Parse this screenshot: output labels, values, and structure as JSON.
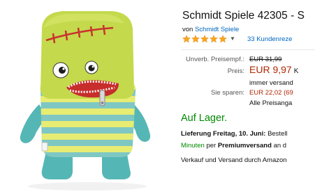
{
  "product": {
    "title": "Schmidt Spiele 42305 - S",
    "brand_prefix": "von",
    "brand": "Schmidt Spiele",
    "rating_stars": 5,
    "reviews": "33 Kundenreze"
  },
  "pricing": {
    "rrp_label": "Unverb. Preisempf.:",
    "rrp_value": "EUR 31,99",
    "price_label": "Preis:",
    "price_value": "EUR 9,97",
    "price_suffix": "K",
    "shipping_note": "immer versand",
    "savings_label": "Sie sparen:",
    "savings_value": "EUR 22,02 (69",
    "all_prices": "Alle Preisanga"
  },
  "availability": {
    "stock": "Auf Lager.",
    "delivery_prefix": "Lieferung Freitag, 10. Juni:",
    "delivery_suffix": "Bestell",
    "minutes": "Minuten",
    "per": "per",
    "premium": "Premiumversand",
    "an": "an d",
    "seller": "Verkauf und Versand durch Amazon"
  },
  "colors": {
    "link": "#0066c0",
    "price_red": "#b12704",
    "stock_green": "#008a00",
    "star": "#ffa41c"
  },
  "icons": {
    "star": "star-icon",
    "caret": "caret-down-icon"
  }
}
